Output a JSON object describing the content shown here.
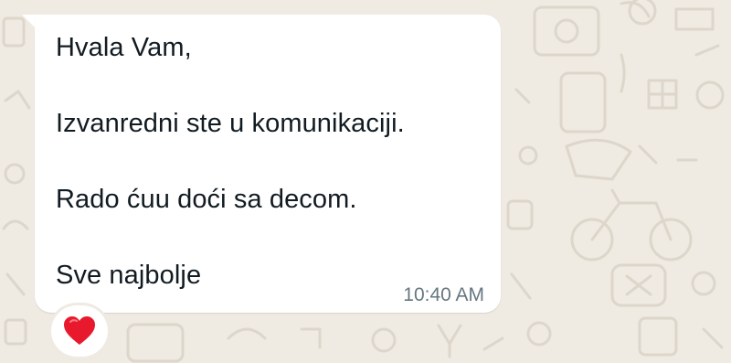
{
  "message": {
    "lines": [
      "Hvala Vam,",
      "Izvanredni ste u komunikaciji.",
      "Rado ćuu doći sa decom.",
      "Sve najbolje"
    ],
    "time": "10:40 AM"
  },
  "reaction": {
    "icon": "red-heart-icon",
    "color": "#e8192c"
  },
  "colors": {
    "wallpaper": "#efeae2",
    "bubble": "#ffffff",
    "text": "#111b21",
    "timestamp": "#667781"
  }
}
